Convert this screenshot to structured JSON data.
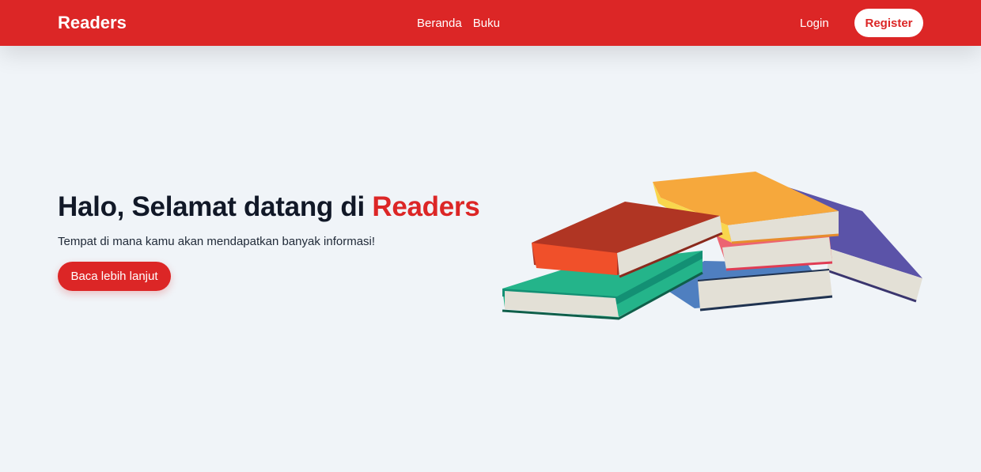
{
  "navbar": {
    "brand": "Readers",
    "links": [
      "Beranda",
      "Buku"
    ],
    "login": "Login",
    "register": "Register"
  },
  "hero": {
    "title_prefix": "Halo, Selamat datang di ",
    "title_accent": "Readers",
    "subtitle": "Tempat di mana kamu akan mendapatkan banyak informasi!",
    "cta": "Baca lebih lanjut",
    "illustration": "stack-of-books-illustration"
  },
  "colors": {
    "primary": "#dc2626",
    "background": "#f0f4f8",
    "heading": "#111827"
  }
}
